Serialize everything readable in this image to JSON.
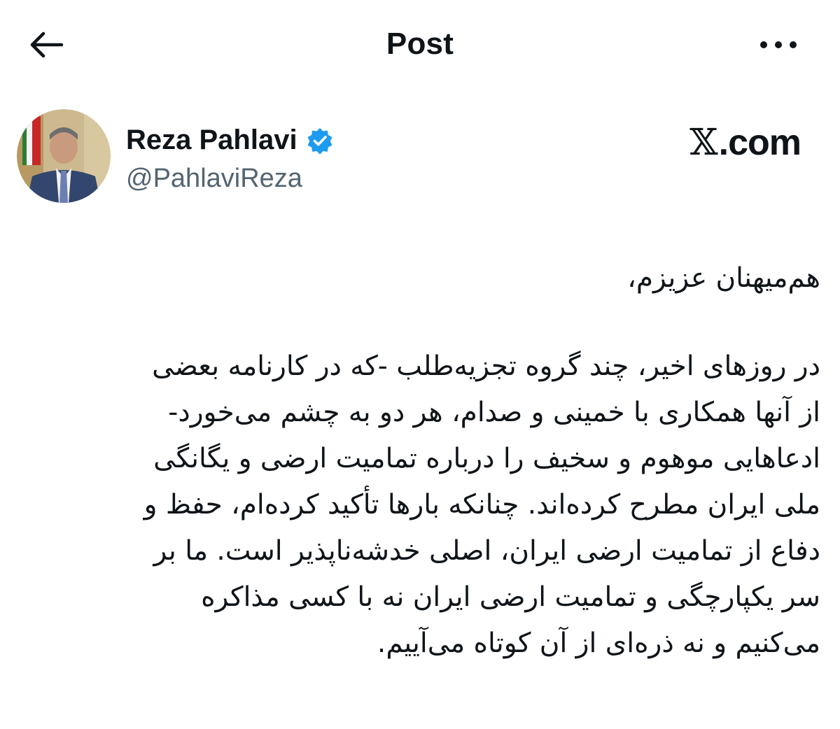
{
  "header": {
    "title": "Post",
    "back_icon": "arrow-left-icon",
    "more_icon": "more-horizontal-icon"
  },
  "author": {
    "display_name": "Reza Pahlavi",
    "handle": "@PahlaviReza",
    "verified": true,
    "verified_color": "#1d9bf0",
    "avatar_icon": "avatar-photo"
  },
  "brand": {
    "x_mark": "𝕏",
    "domain": ".com"
  },
  "post": {
    "greeting": "هم‌میهنان عزیزم،",
    "lines": [
      "در روزهای اخیر، چند گروه تجزیه‌طلب -که در کارنامه بعضی",
      "از آنها همکاری با خمینی و صدام، هر دو به چشم می‌خورد-",
      "ادعاهایی موهوم و سخیف را درباره تمامیت ارضی و یگانگی",
      "ملی ایران مطرح کرده‌اند. چنانکه بارها تأکید کرده‌ام، حفظ و",
      "دفاع از تمامیت ارضی ایران، اصلی خدشه‌ناپذیر است. ما بر",
      "سر یکپارچگی و تمامیت ارضی ایران نه با کسی مذاکره",
      "می‌کنیم و نه ذره‌ای از آن کوتاه می‌آییم."
    ]
  },
  "colors": {
    "text_primary": "#0f1419",
    "text_secondary": "#536471",
    "background": "#ffffff"
  }
}
